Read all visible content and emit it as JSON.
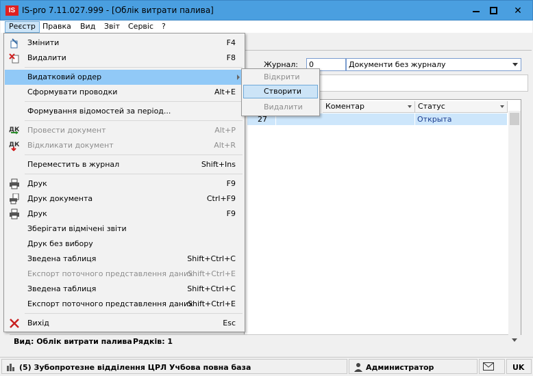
{
  "window": {
    "logo": "IS",
    "title": "IS-pro 7.11.027.999 - [Облік витрати палива]"
  },
  "menubar": {
    "items": [
      "Реєстр",
      "Правка",
      "Вид",
      "Звіт",
      "Сервіс",
      "?"
    ]
  },
  "journal": {
    "label": "Журнал:",
    "number": "0",
    "value": "Документи без журналу"
  },
  "grid": {
    "columns": [
      "Коментар",
      "Статус"
    ],
    "row": {
      "num": "27",
      "comment": "",
      "status": "Открыта"
    }
  },
  "info_bar": {
    "view": "Вид: Облік витрати палива",
    "rows": "Рядків: 1"
  },
  "status_bar": {
    "org": "(5) Зубопротезне відділення ЦРЛ Учбова повна база",
    "user": "Администратор",
    "lang": "UK"
  },
  "dropdown": {
    "items": [
      {
        "label": "Змінити",
        "shortcut": "F4",
        "icon": "edit-icon",
        "enabled": true
      },
      {
        "label": "Видалити",
        "shortcut": "F8",
        "icon": "delete-doc-icon",
        "enabled": true
      },
      {
        "label": "Видатковий ордер",
        "shortcut": "",
        "icon": "",
        "enabled": true,
        "submenu": true
      },
      {
        "label": "Сформувати проводки",
        "shortcut": "Alt+E",
        "icon": "",
        "enabled": true
      },
      {
        "label": "Формування відомостей за період...",
        "shortcut": "",
        "icon": "",
        "enabled": true
      },
      {
        "label": "Провести документ",
        "shortcut": "Alt+P",
        "icon": "post-doc-icon",
        "enabled": false
      },
      {
        "label": "Відкликати документ",
        "shortcut": "Alt+R",
        "icon": "revoke-doc-icon",
        "enabled": false
      },
      {
        "label": "Переместить в журнал",
        "shortcut": "Shift+Ins",
        "icon": "",
        "enabled": true
      },
      {
        "label": "Друк",
        "shortcut": "F9",
        "icon": "printer-icon",
        "enabled": true
      },
      {
        "label": "Друк документа",
        "shortcut": "Ctrl+F9",
        "icon": "print-document-icon",
        "enabled": true
      },
      {
        "label": "Друк",
        "shortcut": "F9",
        "icon": "printer-icon",
        "enabled": true
      },
      {
        "label": "Зберігати відмічені звіти",
        "shortcut": "",
        "icon": "",
        "enabled": true
      },
      {
        "label": "Друк без вибору",
        "shortcut": "",
        "icon": "",
        "enabled": true
      },
      {
        "label": "Зведена таблиця",
        "shortcut": "Shift+Ctrl+C",
        "icon": "",
        "enabled": true
      },
      {
        "label": "Експорт поточного представлення даних",
        "shortcut": "Shift+Ctrl+E",
        "icon": "",
        "enabled": false
      },
      {
        "label": "Зведена таблиця",
        "shortcut": "Shift+Ctrl+C",
        "icon": "",
        "enabled": true
      },
      {
        "label": "Експорт поточного представлення даних",
        "shortcut": "Shift+Ctrl+E",
        "icon": "",
        "enabled": true
      },
      {
        "label": "Вихід",
        "shortcut": "Esc",
        "icon": "exit-x-icon",
        "enabled": true
      }
    ]
  },
  "submenu": {
    "items": [
      {
        "label": "Відкрити",
        "enabled": false
      },
      {
        "label": "Створити",
        "enabled": true
      },
      {
        "label": "Видалити",
        "enabled": false
      }
    ]
  }
}
